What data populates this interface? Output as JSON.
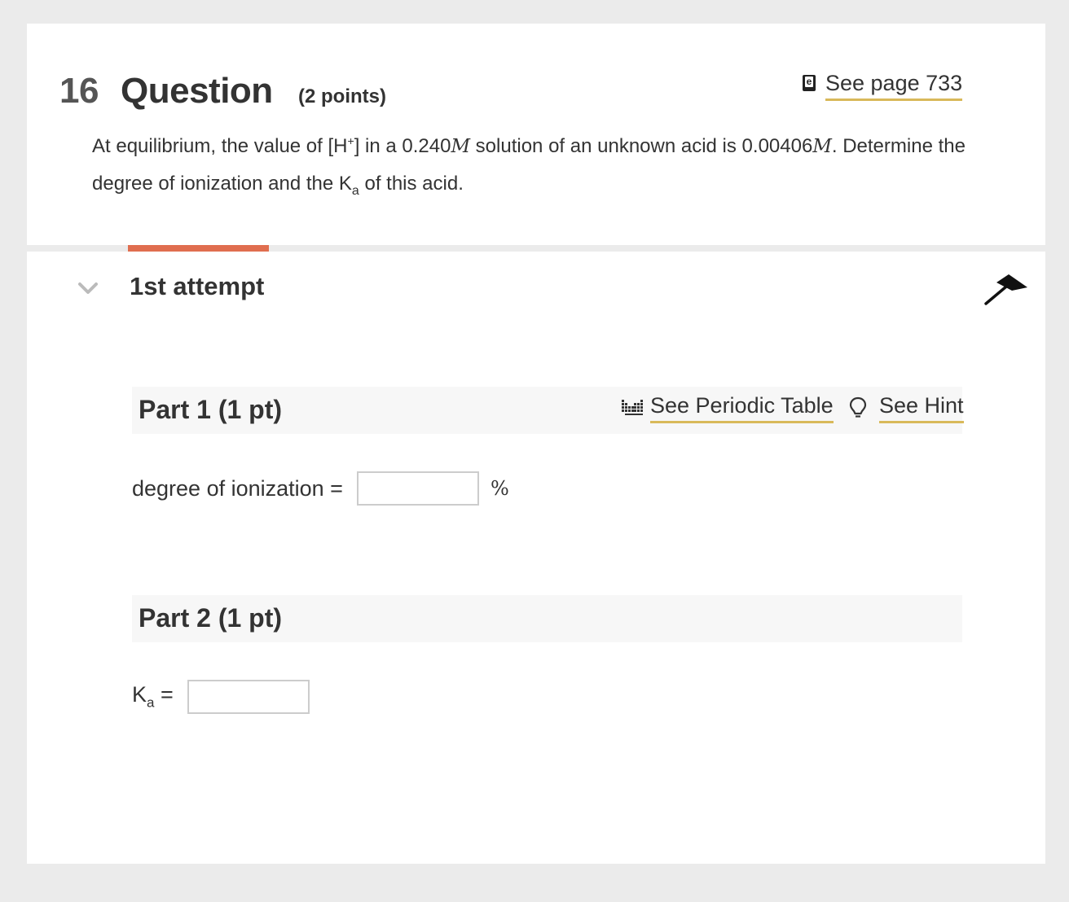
{
  "question": {
    "number": "16",
    "label": "Question",
    "points": "(2 points)",
    "see_page": "See page 733",
    "ebook_letter": "e",
    "prompt": {
      "t1": "At equilibrium, the value of [H",
      "t1_sup": "+",
      "t2": "] in a 0.240",
      "unit_m": "M",
      "t3": " solution of an unknown acid is 0.00406",
      "t4": ". Determine the degree of ionization and the K",
      "t4_sub": "a",
      "t5": " of this acid."
    }
  },
  "attempt": {
    "title": "1st attempt",
    "progress_color": "#e06e4f"
  },
  "part1": {
    "title": "Part 1 (1 pt)",
    "periodic_link": "See Periodic Table",
    "hint_link": "See Hint",
    "field_label": "degree of ionization =",
    "field_value": "",
    "unit": "%"
  },
  "part2": {
    "title": "Part 2 (1 pt)",
    "field_label_main": "K",
    "field_label_sub": "a",
    "field_label_eq": " =",
    "field_value": ""
  },
  "colors": {
    "link_underline": "#d9b95a",
    "accent": "#e06e4f",
    "background": "#ebebeb"
  },
  "icons": [
    "ebook-icon",
    "chevron-down-icon",
    "pin-icon",
    "periodic-table-icon",
    "lightbulb-icon"
  ]
}
